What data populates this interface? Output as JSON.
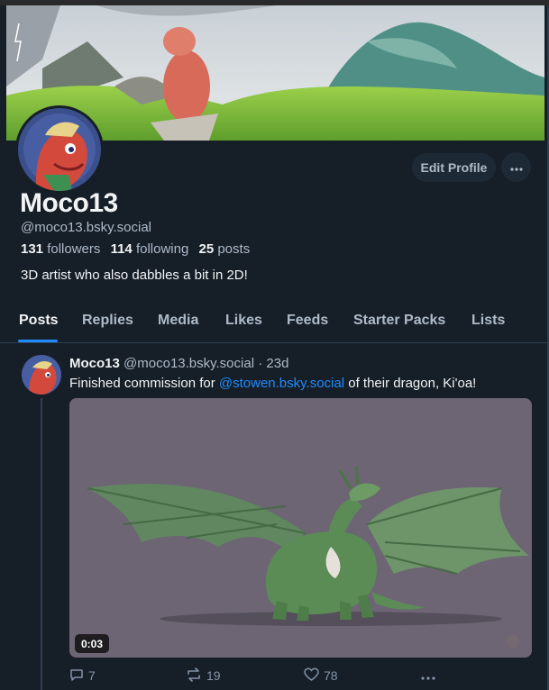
{
  "profile": {
    "display_name": "Moco13",
    "handle": "@moco13.bsky.social",
    "followers_count": "131",
    "followers_label": "followers",
    "following_count": "114",
    "following_label": "following",
    "posts_count": "25",
    "posts_label": "posts",
    "bio": "3D artist who also dabbles a bit in 2D!",
    "edit_button": "Edit Profile",
    "more_icon": "ellipsis-icon"
  },
  "tabs": [
    {
      "label": "Posts",
      "active": true
    },
    {
      "label": "Replies"
    },
    {
      "label": "Media"
    },
    {
      "label": "Likes"
    },
    {
      "label": "Feeds"
    },
    {
      "label": "Starter Packs"
    },
    {
      "label": "Lists"
    }
  ],
  "post": {
    "author": "Moco13",
    "handle": "@moco13.bsky.social",
    "separator": "·",
    "age": "23d",
    "text_before": "Finished commission for ",
    "mention": "@stowen.bsky.social",
    "text_after": " of their dragon, Ki'oa!",
    "video_duration": "0:03",
    "reply_count": "7",
    "repost_count": "19",
    "like_count": "78",
    "more_icon": "ellipsis-icon"
  },
  "colors": {
    "background": "#161e27",
    "accent": "#208bfe",
    "muted_text": "#aebbc9",
    "border": "#2e4052"
  }
}
